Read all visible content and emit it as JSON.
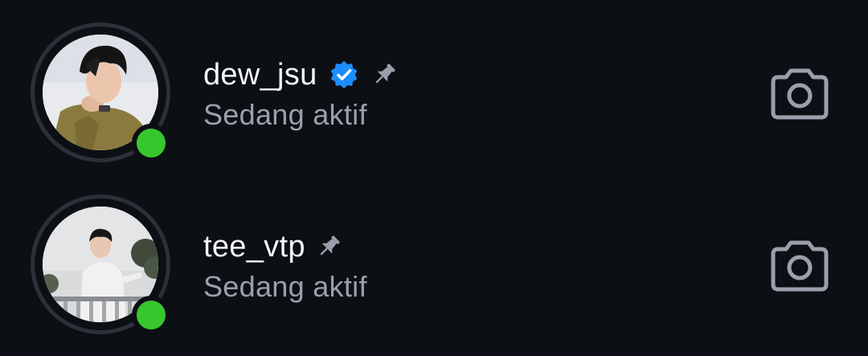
{
  "contacts": [
    {
      "username": "dew_jsu",
      "status": "Sedang aktif",
      "verified": true,
      "pinned": true,
      "online": true,
      "icons": [
        "verified-badge-icon",
        "pin-icon",
        "camera-icon"
      ]
    },
    {
      "username": "tee_vtp",
      "status": "Sedang aktif",
      "verified": false,
      "pinned": true,
      "online": true,
      "icons": [
        "pin-icon",
        "camera-icon"
      ]
    }
  ],
  "colors": {
    "background": "#0c0f14",
    "online_dot": "#37c62d",
    "verified_badge": "#1c8ef9",
    "secondary_text": "#9aa0ab",
    "icon_gray": "#9aa0ab"
  }
}
